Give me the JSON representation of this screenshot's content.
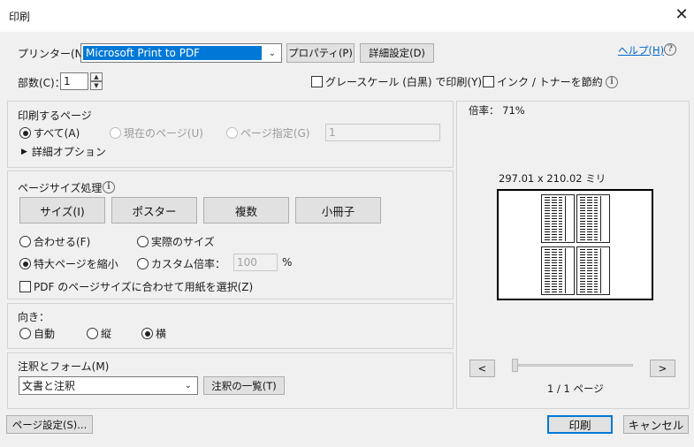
{
  "window": {
    "title": "印刷",
    "close_glyph": "✕"
  },
  "printer": {
    "label": "プリンター(N)：",
    "selected": "Microsoft Print to PDF",
    "properties_button": "プロパティ(P)",
    "advanced_button": "詳細設定(D)"
  },
  "help": {
    "label": "ヘルプ(H)",
    "icon": "question-icon"
  },
  "copies": {
    "label": "部数(C)：",
    "value": "1"
  },
  "options": {
    "grayscale": "グレースケール (白黒) で印刷(Y)",
    "save_ink": "インク / トナーを節約",
    "info_icon": "info-icon"
  },
  "pages_to_print": {
    "heading": "印刷するページ",
    "all": "すべて(A)",
    "current": "現在のページ(U)",
    "specify": "ページ指定(G)",
    "range_value": "1",
    "more_options": "詳細オプション",
    "selected": "all"
  },
  "page_sizing": {
    "heading": "ページサイズ処理",
    "buttons": [
      "サイズ(I)",
      "ポスター",
      "複数",
      "小冊子"
    ],
    "fit": "合わせる(F)",
    "actual_size": "実際のサイズ",
    "shrink_oversized": "特大ページを縮小",
    "custom_scale": "カスタム倍率：",
    "custom_scale_value": "100",
    "percent": "%",
    "choose_paper_by_pdf": "PDF のページサイズに合わせて用紙を選択(Z)",
    "selected": "shrink_oversized"
  },
  "orientation": {
    "heading": "向き：",
    "auto": "自動",
    "portrait": "縦",
    "landscape": "横",
    "selected": "landscape"
  },
  "comments_forms": {
    "heading": "注釈とフォーム(M)",
    "selected": "文書と注釈",
    "summarize_button": "注釈の一覧(T)"
  },
  "preview": {
    "zoom": "倍率： 71%",
    "dimensions": "297.01 x 210.02 ミリ",
    "page_indicator": "1 / 1 ページ",
    "prev": "<",
    "next": ">",
    "slider_position": 0
  },
  "footer": {
    "page_setup_button": "ページ設定(S)...",
    "print_button": "印刷",
    "cancel_button": "キャンセル"
  }
}
